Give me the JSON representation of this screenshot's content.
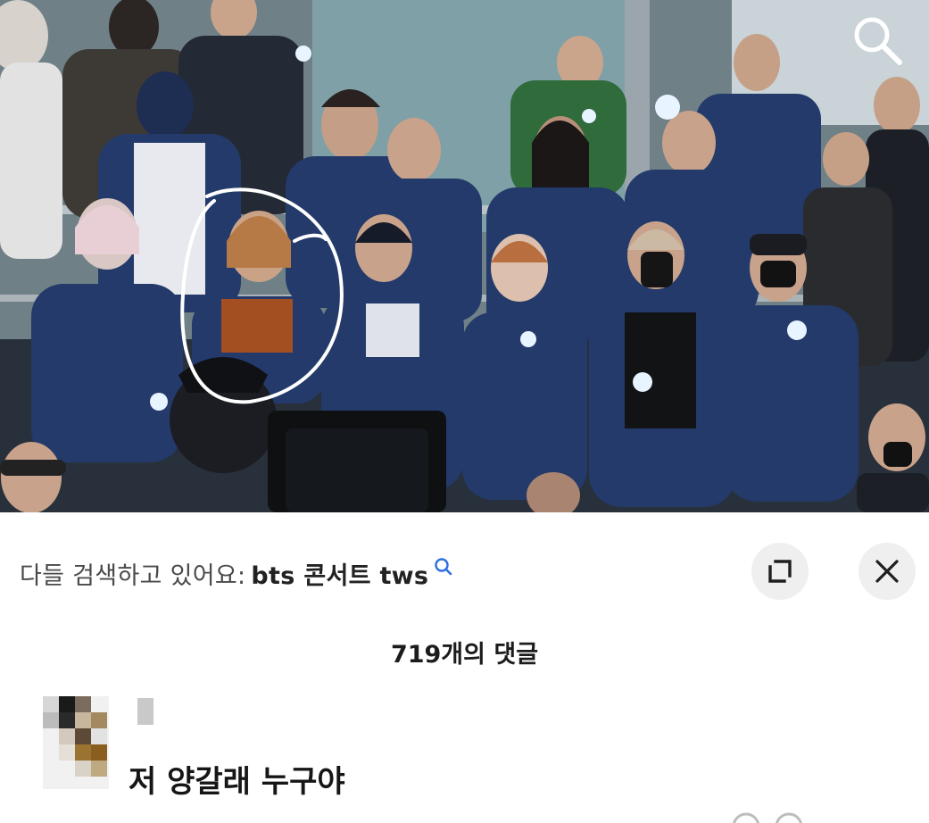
{
  "photo": {
    "search_icon": "search-icon"
  },
  "suggestion": {
    "prefix": "다들 검색하고 있어요:",
    "query": "bts 콘서트 tws",
    "icon": "search-icon"
  },
  "controls": {
    "expand_icon": "expand-icon",
    "close_icon": "close-icon"
  },
  "comments": {
    "count_label": "719개의 댓글",
    "items": [
      {
        "avatar": "avatar",
        "text": "저 양갈래 누구야"
      }
    ]
  },
  "colors": {
    "jacket": "#233a6a",
    "highlight_circle": "#ffffff",
    "button_bg": "#efefef",
    "text_primary": "#1c1c1c",
    "text_secondary": "#4a4a4a"
  }
}
